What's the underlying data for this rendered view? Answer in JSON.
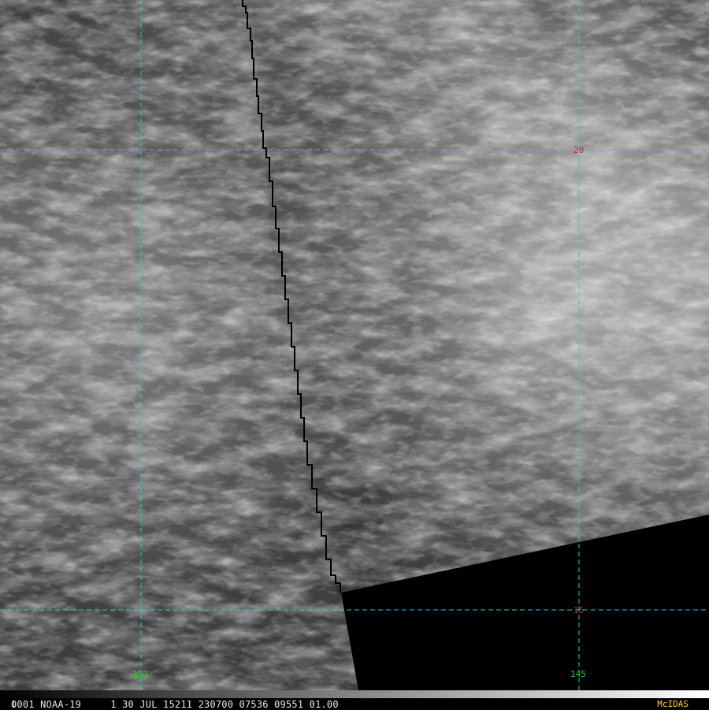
{
  "satellite_image": {
    "footer": {
      "frame_number": "1",
      "status_line": "0001 NOAA-19     1 30 JUL 15211 230700 07536 09551 01.00",
      "software_label": "McIDAS"
    },
    "latitude_labels": [
      "20",
      "15"
    ],
    "longitude_labels": [
      "150",
      "145"
    ],
    "colors": {
      "grid": "#19d0d6",
      "latitude_label": "#d02020",
      "longitude_label": "#20d020",
      "footer_highlight": "#ffd21e"
    }
  }
}
